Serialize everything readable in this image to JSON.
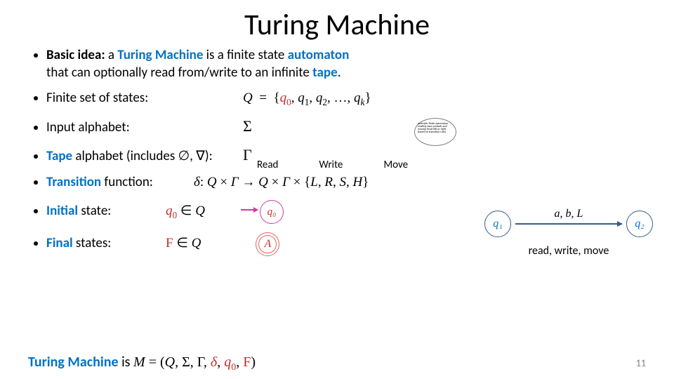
{
  "title": "Turing Machine",
  "bullets": {
    "basic_idea_prefix": "Basic idea:",
    "basic_idea_mid1": " a ",
    "basic_idea_tm": "Turing Machine",
    "basic_idea_mid2": " is a finite state ",
    "basic_idea_autom": "automaton",
    "basic_idea_line2a": "that can optionally read from/write to an infinite ",
    "basic_idea_tape": "tape",
    "basic_idea_dot": ".",
    "states_lbl": "Finite set of states:",
    "states_math": "Q  =  {q₀, q₁, q₂, …, qₖ}",
    "input_lbl": "Input alphabet:",
    "input_math": "Σ",
    "tape_lbl_pre": "Tape",
    "tape_lbl_rest": " alphabet (includes ∅, ∇):",
    "tape_math": "Γ",
    "trans_lbl_pre": "Transition",
    "trans_lbl_rest": " function:",
    "trans_math": "δ: Q × Γ → Q × Γ × {L, R, S, H}",
    "init_lbl_pre": "Initial",
    "init_lbl_rest": " state:",
    "init_math": "q₀ ∈ Q",
    "init_node": "q₀",
    "final_lbl_pre": "Final",
    "final_lbl_rest": " states:",
    "final_math": "F ∈ Q",
    "final_node": "A"
  },
  "annot": {
    "read": "Read",
    "write": "Write",
    "move": "Move"
  },
  "tiny_callout": "example: finite automaton reading tape symbols and moving head left or right based on transition rules",
  "diagram": {
    "q1": "q₁",
    "q2": "q₂",
    "edge_label": "a, b, L",
    "subtitle": "read, write, move"
  },
  "footer": {
    "tm_pre": "Turing Machine",
    "tm_rest": " is ",
    "tm_math": "M = (Q, Σ, Γ, δ, q₀, F)",
    "page": "11"
  }
}
